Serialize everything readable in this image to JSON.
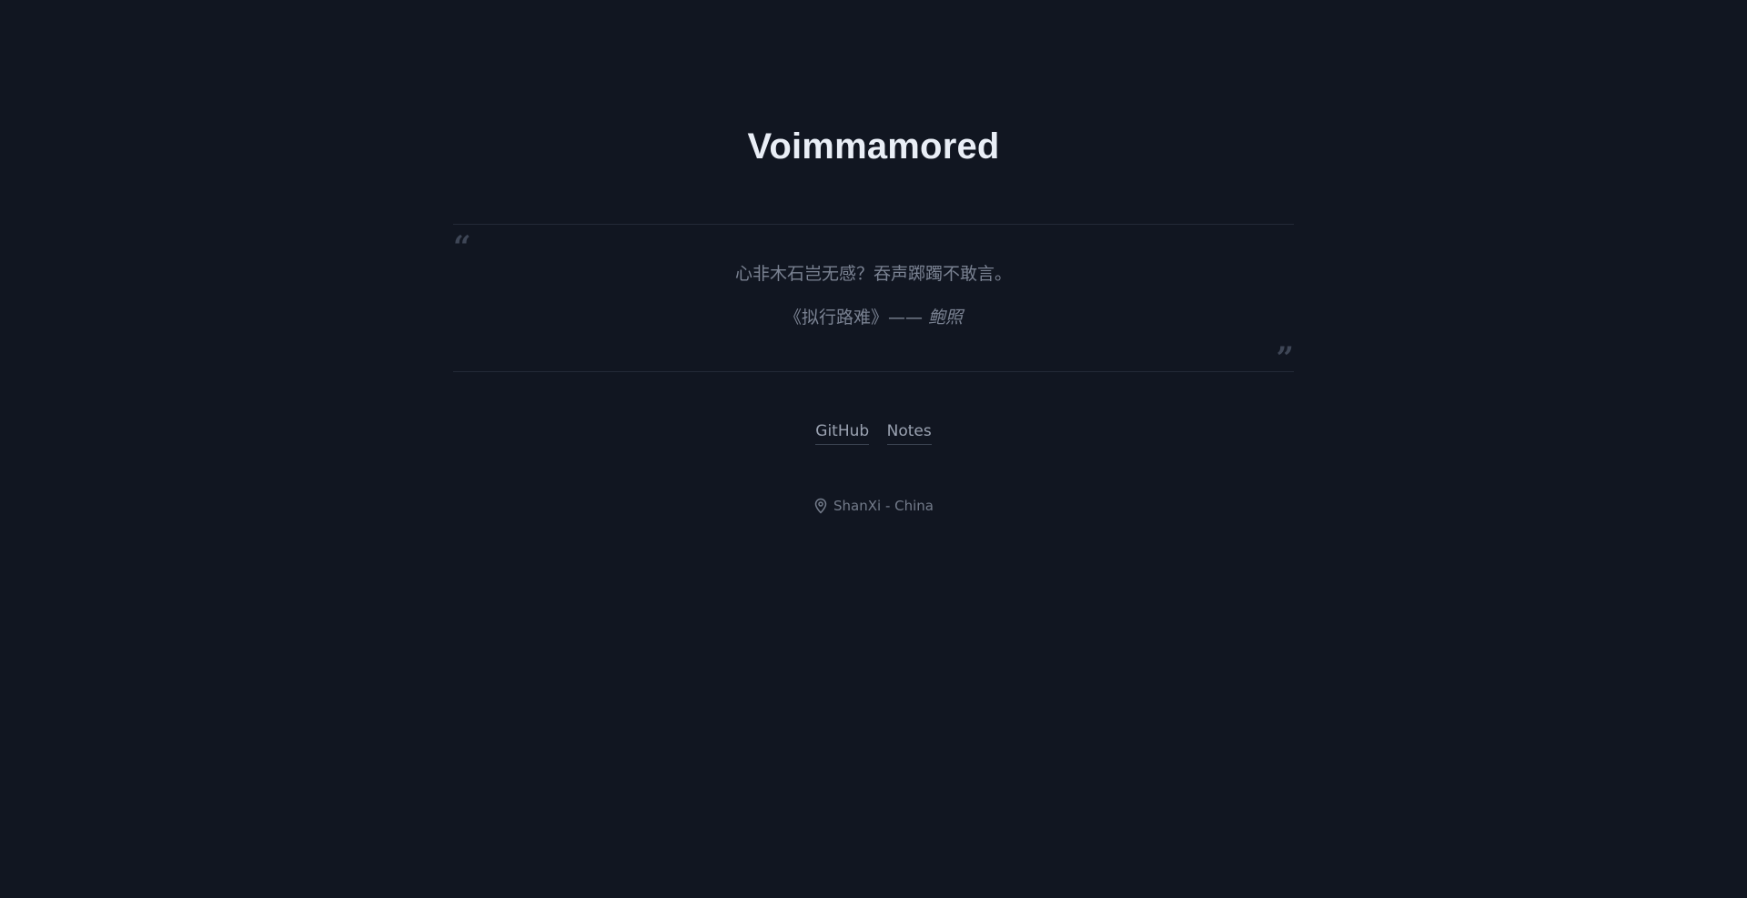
{
  "header": {
    "title": "Voimmamored"
  },
  "quote": {
    "text": "心非木石岂无感？吞声踯躅不敢言。",
    "source_work": "《拟行路难》——",
    "source_author": "鲍照",
    "open_mark": "“",
    "close_mark": "”",
    "icon_open": "quote-open-icon",
    "icon_close": "quote-close-icon"
  },
  "links": [
    {
      "label": "GitHub"
    },
    {
      "label": "Notes"
    }
  ],
  "location": {
    "icon": "map-pin-icon",
    "text": "ShanXi - China"
  },
  "colors": {
    "background": "#111621",
    "title": "#e9eef6",
    "muted_text": "#7a8292",
    "link": "#9aa2b1",
    "divider": "#232a37"
  }
}
